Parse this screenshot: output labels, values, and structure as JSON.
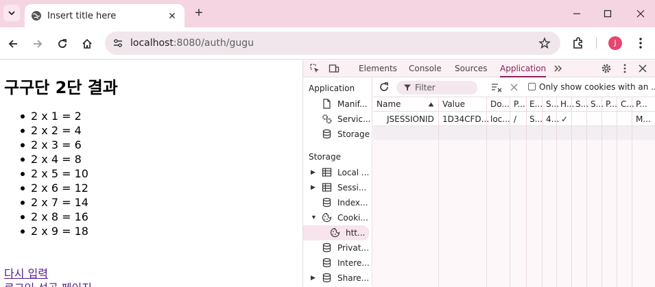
{
  "browser": {
    "tab_title": "Insert title here",
    "url_host": "localhost",
    "url_rest": ":8080/auth/gugu",
    "avatar_letter": "J"
  },
  "page": {
    "heading": "구구단 2단 결과",
    "results": [
      "2 x 1 = 2",
      "2 x 2 = 4",
      "2 x 3 = 6",
      "2 x 4 = 8",
      "2 x 5 = 10",
      "2 x 6 = 12",
      "2 x 7 = 14",
      "2 x 8 = 16",
      "2 x 9 = 18"
    ],
    "link_retry": "다시 입력",
    "link_login": "로그인 성공 페이지"
  },
  "devtools": {
    "tabs": [
      "Elements",
      "Console",
      "Sources",
      "Application"
    ],
    "active_tab": "Application",
    "sidebar": {
      "application_header": "Application",
      "application_items": [
        "Manif...",
        "Servic...",
        "Storage"
      ],
      "storage_header": "Storage",
      "storage_items": [
        "Local ...",
        "Sessi...",
        "Index...",
        "Cooki...",
        "htt...",
        "Privat...",
        "Intere...",
        "Share..."
      ]
    },
    "filter_placeholder": "Filter",
    "only_show_label": "Only show cookies with an ...",
    "columns": [
      "Name",
      "Value",
      "Do...",
      "P...",
      "E...",
      "S...",
      "H...",
      "S...",
      "S...",
      "P...",
      "C...",
      "P..."
    ],
    "rows": [
      [
        "JSESSIONID",
        "1D34CFD...",
        "loc...",
        "/",
        "S...",
        "4...",
        "✓",
        "",
        "",
        "",
        "",
        "M..."
      ]
    ]
  },
  "colors": {
    "tabstrip": "#f6d5e3",
    "accent": "#8a1f5c",
    "avatar": "#e8456f",
    "link": "#551a8b"
  }
}
